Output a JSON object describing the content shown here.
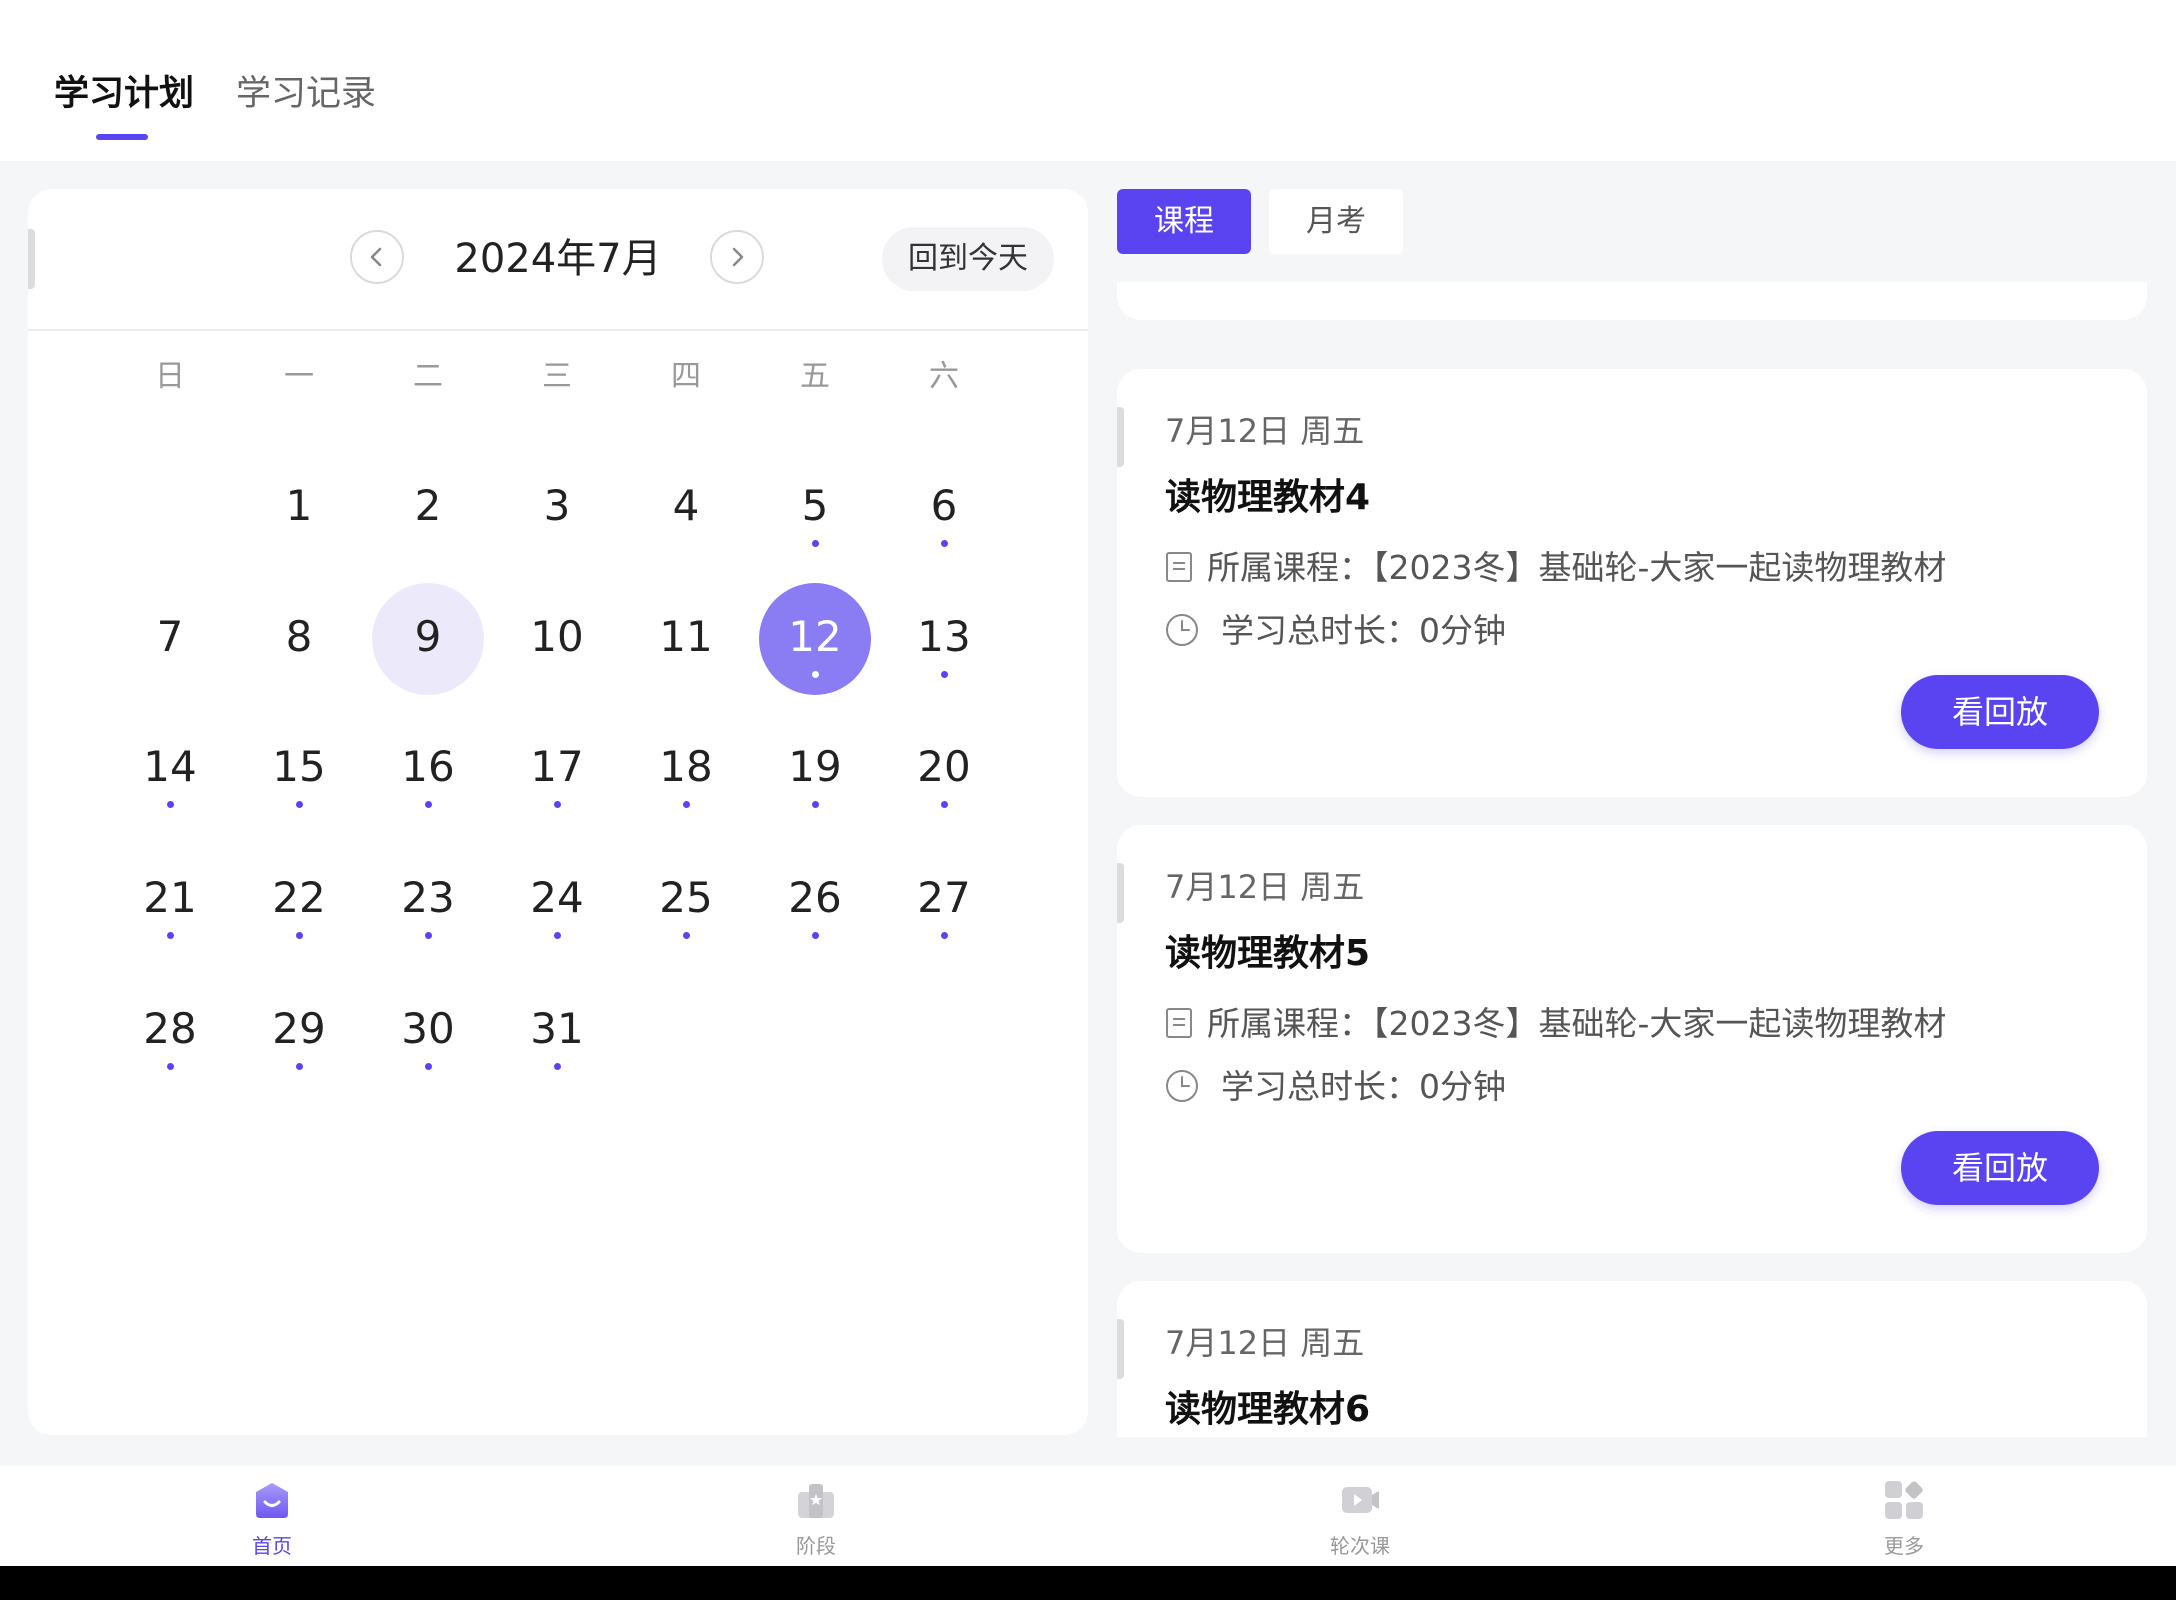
{
  "top_tabs": [
    {
      "label": "学习计划",
      "active": true
    },
    {
      "label": "学习记录",
      "active": false
    }
  ],
  "calendar": {
    "month_label": "2024年7月",
    "today_button": "回到今天",
    "prev_icon": "chevron-left-icon",
    "next_icon": "chevron-right-icon",
    "weekdays": [
      "日",
      "一",
      "二",
      "三",
      "四",
      "五",
      "六"
    ],
    "days": [
      {
        "n": "1",
        "dot": false
      },
      {
        "n": "2",
        "dot": false
      },
      {
        "n": "3",
        "dot": false
      },
      {
        "n": "4",
        "dot": false
      },
      {
        "n": "5",
        "dot": true
      },
      {
        "n": "6",
        "dot": true
      },
      {
        "n": "7",
        "dot": false
      },
      {
        "n": "8",
        "dot": false
      },
      {
        "n": "9",
        "dot": false,
        "state": "selected"
      },
      {
        "n": "10",
        "dot": false
      },
      {
        "n": "11",
        "dot": false
      },
      {
        "n": "12",
        "dot": true,
        "state": "today"
      },
      {
        "n": "13",
        "dot": true
      },
      {
        "n": "14",
        "dot": true
      },
      {
        "n": "15",
        "dot": true
      },
      {
        "n": "16",
        "dot": true
      },
      {
        "n": "17",
        "dot": true
      },
      {
        "n": "18",
        "dot": true
      },
      {
        "n": "19",
        "dot": true
      },
      {
        "n": "20",
        "dot": true
      },
      {
        "n": "21",
        "dot": true
      },
      {
        "n": "22",
        "dot": true
      },
      {
        "n": "23",
        "dot": true
      },
      {
        "n": "24",
        "dot": true
      },
      {
        "n": "25",
        "dot": true
      },
      {
        "n": "26",
        "dot": true
      },
      {
        "n": "27",
        "dot": true
      },
      {
        "n": "28",
        "dot": true
      },
      {
        "n": "29",
        "dot": true
      },
      {
        "n": "30",
        "dot": true
      },
      {
        "n": "31",
        "dot": true
      }
    ]
  },
  "segment_tabs": [
    {
      "label": "课程",
      "active": true
    },
    {
      "label": "月考",
      "active": false
    }
  ],
  "cards": [
    {
      "date": "7月12日 周五",
      "title": "读物理教材4",
      "course_label": "所属课程：",
      "course_value": "【2023冬】基础轮-大家一起读物理教材",
      "duration_label": "学习总时长：",
      "duration_value": "0分钟",
      "button": "看回放"
    },
    {
      "date": "7月12日 周五",
      "title": "读物理教材5",
      "course_label": "所属课程：",
      "course_value": "【2023冬】基础轮-大家一起读物理教材",
      "duration_label": "学习总时长：",
      "duration_value": "0分钟",
      "button": "看回放"
    },
    {
      "date": "7月12日 周五",
      "title": "读物理教材6"
    }
  ],
  "bottom_nav": [
    {
      "label": "首页",
      "icon": "home-icon",
      "active": true
    },
    {
      "label": "阶段",
      "icon": "stage-icon",
      "active": false
    },
    {
      "label": "轮次课",
      "icon": "video-icon",
      "active": false
    },
    {
      "label": "更多",
      "icon": "more-grid-icon",
      "active": false
    }
  ],
  "colors": {
    "accent": "#5a43f0",
    "today_circle": "#8a7cf2",
    "selected_circle": "#ece9fb",
    "background": "#f5f6f8"
  }
}
